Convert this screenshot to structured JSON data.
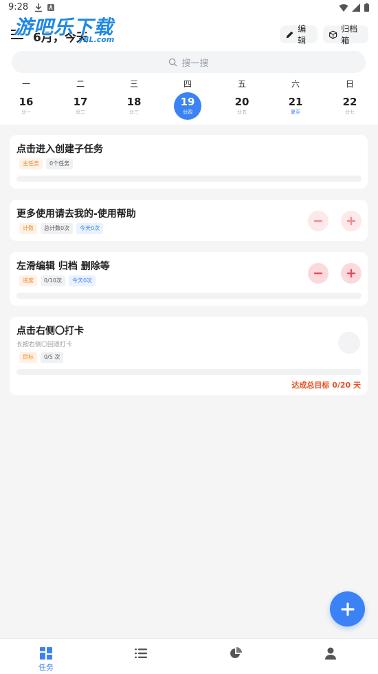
{
  "status_bar": {
    "time": "9:28"
  },
  "watermark": {
    "text": "游吧乐下载",
    "sub": "yBL.com"
  },
  "header": {
    "title": "6月，今天",
    "edit_label": "编辑",
    "archive_label": "归档箱"
  },
  "search": {
    "placeholder": "搜一搜"
  },
  "week": [
    {
      "dow": "一",
      "date": "16",
      "lunar": "廿一"
    },
    {
      "dow": "二",
      "date": "17",
      "lunar": "廿二"
    },
    {
      "dow": "三",
      "date": "18",
      "lunar": "廿三"
    },
    {
      "dow": "四",
      "date": "19",
      "lunar": "廿四",
      "today": true
    },
    {
      "dow": "五",
      "date": "20",
      "lunar": "廿五"
    },
    {
      "dow": "六",
      "date": "21",
      "lunar": "夏至",
      "highlight": true
    },
    {
      "dow": "日",
      "date": "22",
      "lunar": "廿七"
    }
  ],
  "tasks": [
    {
      "title": "点击进入创建子任务",
      "tags": [
        "主任务",
        "0个任务"
      ],
      "progress": 0
    },
    {
      "title": "更多使用请去我的-使用帮助",
      "tags": [
        "计数",
        "总计数0次",
        "今天0次"
      ]
    },
    {
      "title": "左滑编辑 归档 删除等",
      "tags": [
        "进度",
        "0/10次",
        "今天0次"
      ],
      "progress": 0
    },
    {
      "title": "点击右侧〇打卡",
      "subtitle": "长按右侧〇回退打卡",
      "tags": [
        "目标",
        "0/5 次"
      ],
      "progress": 0,
      "goal": "达成总目标 0/20 天"
    }
  ],
  "bottom_nav": {
    "tasks_label": "任务"
  },
  "colors": {
    "accent": "#3b82f6",
    "goal": "#e8501f",
    "minus": "#e84c5c"
  }
}
